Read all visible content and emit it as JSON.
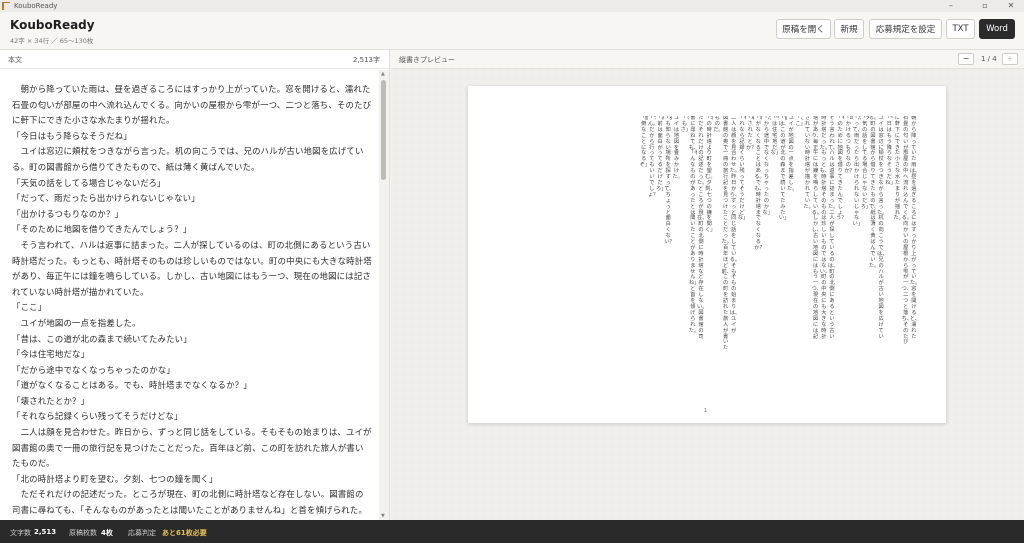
{
  "window": {
    "title": "KouboReady"
  },
  "header": {
    "title": "KouboReady",
    "subtitle": "42字 × 34行 ／ 65〜130枚",
    "buttons": {
      "open": "原稿を開く",
      "new": "新規",
      "rules": "応募規定を設定",
      "txt": "TXT",
      "word": "Word"
    }
  },
  "editor": {
    "label": "本文",
    "count": "2,513字",
    "paragraphs": [
      "　朝から降っていた雨は、昼を過ぎるころにはすっかり上がっていた。窓を開けると、濡れた石畳の匂いが部屋の中へ流れ込んでくる。向かいの屋根から雫が一つ、二つと落ち、そのたびに軒下にできた小さな水たまりが揺れた。",
      "「今日はもう降らなそうだね」",
      "　ユイは窓辺に頬杖をつきながら言った。机の向こうでは、兄のハルが古い地図を広げている。町の図書館から借りてきたもので、紙は薄く黄ばんでいた。",
      "「天気の話をしてる場合じゃないだろ」",
      "「だって、雨だったら出かけられないじゃない」",
      "「出かけるつもりなのか？」",
      "「そのために地図を借りてきたんでしょう？」",
      "　そう言われて、ハルは返事に詰まった。二人が探しているのは、町の北側にあるという古い時計塔だった。もっとも、時計塔そのものは珍しいものではない。町の中央にも大きな時計塔があり、毎正午には鐘を鳴らしている。しかし、古い地図にはもう一つ、現在の地図には記されていない時計塔が描かれていた。",
      "「ここ」",
      "　ユイが地図の一点を指差した。",
      "「昔は、この道が北の森まで続いてたみたい」",
      "「今は住宅地だな」",
      "「だから途中でなくなっちゃったのかな」",
      "「道がなくなることはある。でも、時計塔までなくなるか？」",
      "「壊されたとか？」",
      "「それなら記録くらい残ってそうだけどな」",
      "　二人は顔を見合わせた。昨日から、ずっと同じ話をしている。そもそもの始まりは、ユイが図書館の奥で一冊の旅行記を見つけたことだった。百年ほど前、この町を訪れた旅人が書いたものだ。",
      "「北の時計塔より町を望む。夕刻、七つの鐘を聞く」",
      "　ただそれだけの記述だった。ところが現在、町の北側に時計塔など存在しない。図書館の司書に尋ねても、「そんなものがあったとは聞いたことがありませんね」と首を傾げられた。"
    ]
  },
  "preview": {
    "label": "縦書きプレビュー",
    "prev": "−",
    "next": "+",
    "page_indicator": "1 / 4",
    "page_number": "1",
    "columns": [
      "朝から降っていた雨は、昼を過ぎるころにはすっかり上がっていた。窓を開けると、濡れた",
      "石畳の匂いが部屋の中へ流れ込んでくる。向かいの屋根から雫が一つ、二つと落ち、そのたび",
      "に軒下にできた小さな水たまりが揺れた。",
      "「今日はもう降らなそうだね」",
      "ユイは窓辺に頬杖をつきながら言った。机の向こうでは、兄のハルが古い地図を広げてい",
      "る。町の図書館から借りてきたもので、紙は薄く黄ばんでいた。",
      "「天気の話をしてる場合じゃないだろ」",
      "「だって、雨だったら出かけられないじゃない」",
      "「出かけるつもりなのか？」",
      "「そのために地図を借りてきたんでしょう？」",
      "そう言われて、ハルは返事に詰まった。二人が探しているのは、町の北側にあるという古い",
      "時計塔だった。もっとも、時計塔そのものは珍しいものではない。町の中央にも大きな時計",
      "塔があり、毎正午には鐘を鳴らしている。しかし、古い地図にはもう一つ、現在の地図には記",
      "されていない時計塔が描かれていた。",
      "「ここ」",
      "ユイが地図の一点を指差した。",
      "「昔は、この道が北の森まで続いてたみたい」",
      "「今は住宅地だな」",
      "「だから途中でなくなっちゃったのかな」",
      "「道がなくなることはある。でも、時計塔までなくなるか？」",
      "「壊されたとか？」",
      "「それなら記録くらい残ってそうだけどな」",
      "二人は顔を見合わせた。昨日から、ずっと同じ話をしている。そもそもの始まりは、ユイが",
      "図書館の奥で一冊の旅行記を見つけたことだった。百年ほど前、この町を訪れた旅人が書いた",
      "ものだ。",
      "「北の時計塔より町を望む。夕刻、七つの鐘を聞く」",
      "ただそれだけの記述だった。ところが現在、町の北側に時計塔など存在しない。図書館の司",
      "書に尋ねても、「そんなものがあったとは聞いたことがありませんね」と首を傾げられた。",
      "「でもさ」",
      "ユイは地図を畳みかけた。",
      "「誰も知らない場所を探すって、ちょっと面白くない？」",
      "「お前は面白がってるだけだろ」",
      "「うん。だから行ってもいいでしょ？」",
      "「面倒なことになるぞ」"
    ]
  },
  "status": {
    "chars_label": "文字数",
    "chars_value": "2,513",
    "sheets_label": "原稿枚数",
    "sheets_value": "4枚",
    "judge_label": "応募判定",
    "judge_value": "あと61枚必要"
  },
  "colors": {
    "accent": "#2b2b2b",
    "warning": "#e7c15a"
  }
}
